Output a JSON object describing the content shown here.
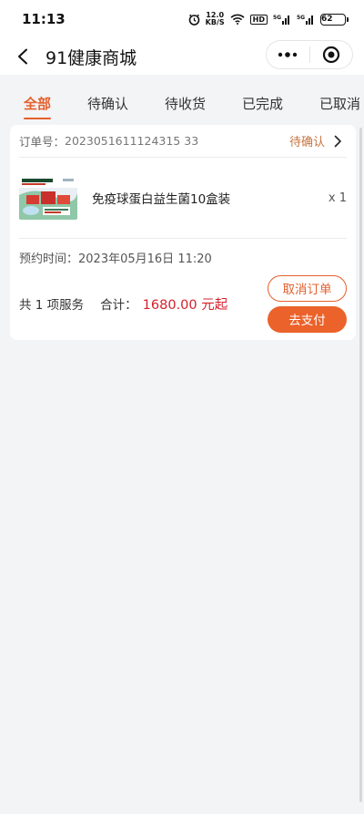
{
  "status_bar": {
    "time": "11:13",
    "speed_value": "12.0",
    "speed_unit": "KB/S",
    "hd": "HD",
    "signal1": "5G",
    "signal2": "5G",
    "battery": "62"
  },
  "nav": {
    "title": "91健康商城",
    "back_icon": "chevron-left-icon",
    "more_icon": "more-icon",
    "close_icon": "target-icon"
  },
  "tabs": [
    {
      "label": "全部",
      "active": true
    },
    {
      "label": "待确认",
      "active": false
    },
    {
      "label": "待收货",
      "active": false
    },
    {
      "label": "已完成",
      "active": false
    },
    {
      "label": "已取消",
      "active": false
    }
  ],
  "order": {
    "order_no_label": "订单号：",
    "order_no": "2023051611124315 33",
    "status": "待确认",
    "product": {
      "name": "免疫球蛋白益生菌10盒装",
      "qty": "x 1"
    },
    "appointment_label": "预约时间：",
    "appointment_time": "2023年05月16日 11:20",
    "service_count": "共 1 项服务",
    "total_label": "合计：",
    "total_amount": "1680.00 元起",
    "cancel_label": "取消订单",
    "pay_label": "去支付"
  },
  "colors": {
    "accent": "#e4602d",
    "price": "#d4202c",
    "background": "#f3f4f6"
  }
}
